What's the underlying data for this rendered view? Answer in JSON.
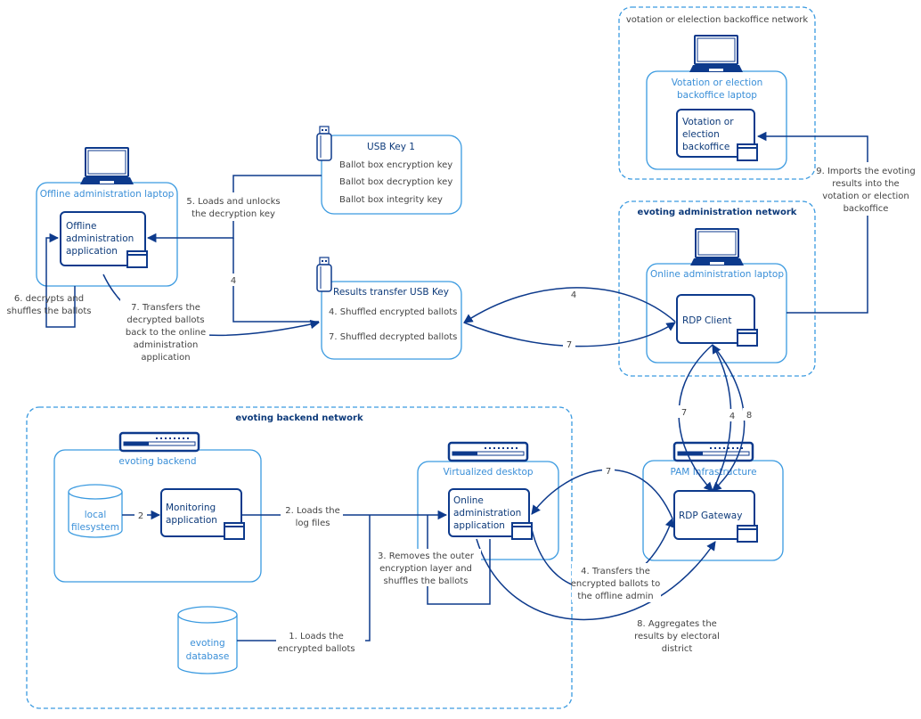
{
  "colors": {
    "network_border": "#3a9ae0",
    "host_border": "#3a9ae0",
    "app_border": "#0d3a8c",
    "edge": "#0d3a8c",
    "label_text": "#444444",
    "host_text": "#3a8fd8"
  },
  "networks": {
    "backoffice": {
      "title": "votation or elelection backoffice network"
    },
    "admin": {
      "title": "evoting administration network"
    },
    "backend": {
      "title": "evoting backend network"
    }
  },
  "hosts": {
    "backoffice_laptop": {
      "title_line1": "Votation or election",
      "title_line2": "backoffice laptop",
      "icon": "laptop-icon"
    },
    "offline_laptop": {
      "title": "Offline administration laptop",
      "icon": "laptop-icon"
    },
    "online_laptop": {
      "title": "Online administration laptop",
      "icon": "laptop-icon"
    },
    "evoting_backend": {
      "title": "evoting backend",
      "icon": "server-icon"
    },
    "virtualized_desktop": {
      "title": "Virtualized desktop",
      "icon": "server-icon"
    },
    "pam": {
      "title": "PAM Infrastructure",
      "icon": "server-icon"
    }
  },
  "apps": {
    "backoffice_app": {
      "lines": [
        "Votation or",
        "election",
        "backoffice"
      ]
    },
    "offline_app": {
      "lines": [
        "Offline",
        "administration",
        "application"
      ]
    },
    "rdp_client": {
      "lines": [
        "RDP Client"
      ]
    },
    "monitoring_app": {
      "lines": [
        "Monitoring",
        "application"
      ]
    },
    "online_app": {
      "lines": [
        "Online",
        "administration",
        "application"
      ]
    },
    "rdp_gateway": {
      "lines": [
        "RDP Gateway"
      ]
    }
  },
  "usb_keys": {
    "usb_key_1": {
      "title": "USB Key 1",
      "items": [
        "Ballot box encryption key",
        "Ballot box decryption key",
        "Ballot box integrity key"
      ]
    },
    "results_usb": {
      "title": "Results transfer USB Key",
      "items": [
        "4. Shuffled encrypted ballots",
        "7. Shuffled decrypted ballots"
      ]
    }
  },
  "databases": {
    "local_fs": {
      "lines": [
        "local",
        "filesystem"
      ]
    },
    "evoting_db": {
      "lines": [
        "evoting",
        "database"
      ]
    }
  },
  "edge_labels": {
    "step1": [
      "1. Loads the",
      "encrypted ballots"
    ],
    "step2": [
      "2. Loads the",
      "log files"
    ],
    "step2_short": "2",
    "step3": [
      "3. Removes the outer",
      "encryption layer and",
      "shuffles the ballots"
    ],
    "step4": [
      "4. Transfers the",
      "encrypted ballots to",
      "the offline admin"
    ],
    "step4_short": "4",
    "step5": [
      "5. Loads and unlocks",
      "the decryption key"
    ],
    "step6": [
      "6. decrypts and",
      "shuffles the ballots"
    ],
    "step7": [
      "7. Transfers the",
      "decrypted ballots",
      "back to the online",
      "administration",
      "application"
    ],
    "step7_short": "7",
    "step8": [
      "8. Aggregates the",
      "results  by electoral",
      "district"
    ],
    "step8_short": "8",
    "step9": [
      "9. Imports the evoting",
      "results into the",
      "votation or election",
      "backoffice"
    ]
  }
}
